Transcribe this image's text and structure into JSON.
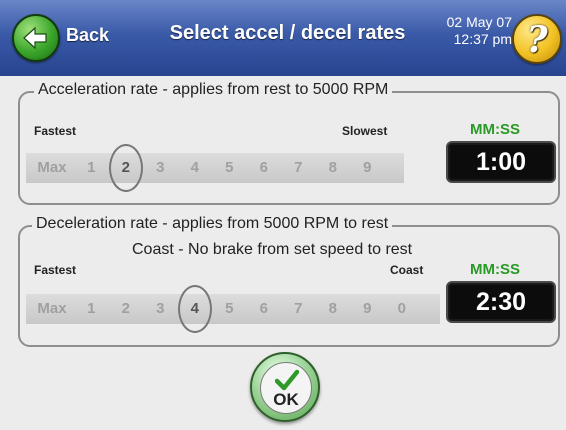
{
  "header": {
    "back_label": "Back",
    "title": "Select accel / decel rates",
    "date": "02 May 07",
    "time": "12:37 pm",
    "help_glyph": "?",
    "back_icon": "arrow-left-icon",
    "help_icon": "question-mark-icon"
  },
  "acceleration": {
    "legend": "Acceleration rate - applies from rest to 5000 RPM",
    "left_label": "Fastest",
    "right_label": "Slowest",
    "time_label": "MM:SS",
    "time_value": "1:00",
    "steps": [
      "Max",
      "1",
      "2",
      "3",
      "4",
      "5",
      "6",
      "7",
      "8",
      "9"
    ],
    "selected": "2"
  },
  "deceleration": {
    "legend": "Deceleration rate - applies from 5000 RPM to rest",
    "subtitle": "Coast - No brake from set speed to rest",
    "left_label": "Fastest",
    "right_label": "Coast",
    "time_label": "MM:SS",
    "time_value": "2:30",
    "steps": [
      "Max",
      "1",
      "2",
      "3",
      "4",
      "5",
      "6",
      "7",
      "8",
      "9",
      "0"
    ],
    "selected": "4"
  },
  "ok": {
    "label": "OK",
    "icon": "checkmark-icon"
  },
  "colors": {
    "header": "#3a5aa8",
    "accent_green": "#2a9a26",
    "display_bg": "#0c0c0c"
  }
}
